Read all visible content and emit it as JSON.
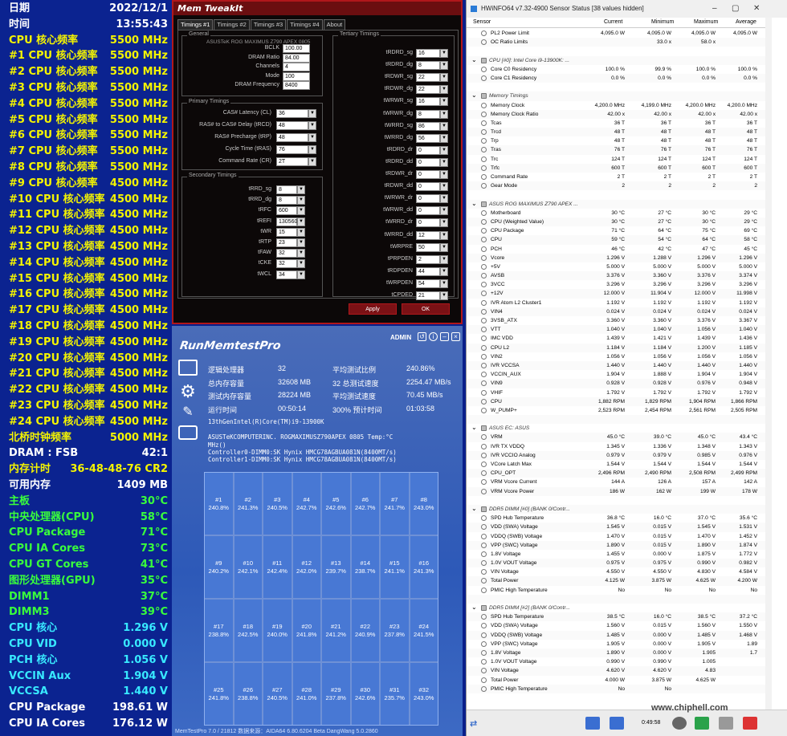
{
  "osd": [
    [
      "日期",
      "2022/12/1",
      "w"
    ],
    [
      "时间",
      "13:55:43",
      "w"
    ],
    [
      "CPU 核心频率",
      "5500 MHz",
      "y"
    ],
    [
      "#1 CPU 核心频率",
      "5500 MHz",
      "y"
    ],
    [
      "#2 CPU 核心频率",
      "5500 MHz",
      "y"
    ],
    [
      "#3 CPU 核心频率",
      "5500 MHz",
      "y"
    ],
    [
      "#4 CPU 核心频率",
      "5500 MHz",
      "y"
    ],
    [
      "#5 CPU 核心频率",
      "5500 MHz",
      "y"
    ],
    [
      "#6 CPU 核心频率",
      "5500 MHz",
      "y"
    ],
    [
      "#7 CPU 核心频率",
      "5500 MHz",
      "y"
    ],
    [
      "#8 CPU 核心频率",
      "5500 MHz",
      "y"
    ],
    [
      "#9 CPU 核心频率",
      "4500 MHz",
      "y"
    ],
    [
      "#10 CPU 核心频率",
      "4500 MHz",
      "y"
    ],
    [
      "#11 CPU 核心频率",
      "4500 MHz",
      "y"
    ],
    [
      "#12 CPU 核心频率",
      "4500 MHz",
      "y"
    ],
    [
      "#13 CPU 核心频率",
      "4500 MHz",
      "y"
    ],
    [
      "#14 CPU 核心频率",
      "4500 MHz",
      "y"
    ],
    [
      "#15 CPU 核心频率",
      "4500 MHz",
      "y"
    ],
    [
      "#16 CPU 核心频率",
      "4500 MHz",
      "y"
    ],
    [
      "#17 CPU 核心频率",
      "4500 MHz",
      "y"
    ],
    [
      "#18 CPU 核心频率",
      "4500 MHz",
      "y"
    ],
    [
      "#19 CPU 核心频率",
      "4500 MHz",
      "y"
    ],
    [
      "#20 CPU 核心频率",
      "4500 MHz",
      "y"
    ],
    [
      "#21 CPU 核心频率",
      "4500 MHz",
      "y"
    ],
    [
      "#22 CPU 核心频率",
      "4500 MHz",
      "y"
    ],
    [
      "#23 CPU 核心频率",
      "4500 MHz",
      "y"
    ],
    [
      "#24 CPU 核心频率",
      "4500 MHz",
      "y"
    ],
    [
      "北桥时钟频率",
      "5000 MHz",
      "y"
    ],
    [
      "DRAM : FSB",
      "42:1",
      "w"
    ],
    [
      "内存计时",
      "36-48-48-76 CR2",
      "y"
    ],
    [
      "可用内存",
      "1409 MB",
      "w"
    ],
    [
      "主板",
      "30°C",
      "g"
    ],
    [
      "中央处理器(CPU)",
      "58°C",
      "g"
    ],
    [
      "CPU Package",
      "71°C",
      "g"
    ],
    [
      "CPU IA Cores",
      "73°C",
      "g"
    ],
    [
      "CPU GT Cores",
      "41°C",
      "g"
    ],
    [
      "图形处理器(GPU)",
      "35°C",
      "g"
    ],
    [
      "DIMM1",
      "37°C",
      "g"
    ],
    [
      "DIMM3",
      "39°C",
      "g"
    ],
    [
      "CPU 核心",
      "1.296 V",
      "c"
    ],
    [
      "CPU VID",
      "0.000 V",
      "c"
    ],
    [
      "PCH 核心",
      "1.056 V",
      "c"
    ],
    [
      "VCCIN Aux",
      "1.904 V",
      "c"
    ],
    [
      "VCCSA",
      "1.440 V",
      "c"
    ],
    [
      "CPU Package",
      "198.61 W",
      "w"
    ],
    [
      "CPU IA Cores",
      "176.12 W",
      "w"
    ]
  ],
  "memtweak": {
    "title": "Mem TweakIt",
    "tabs": [
      "Timings #1",
      "Timings #2",
      "Timings #3",
      "Timings #4",
      "About"
    ],
    "general_label": "General",
    "board": "ASUSTeK ROG MAXIMUS Z790 APEX 0805",
    "general": [
      [
        "BCLK",
        "100.00"
      ],
      [
        "DRAM Ratio",
        "84.00"
      ],
      [
        "Channels",
        "4"
      ],
      [
        "Mode",
        "100"
      ],
      [
        "DRAM Frequency",
        "8400"
      ]
    ],
    "primary_label": "Primary Timings",
    "primary": [
      [
        "CAS# Latency (CL)",
        "36"
      ],
      [
        "RAS# to CAS# Delay (tRCD)",
        "48"
      ],
      [
        "RAS# Precharge (tRP)",
        "48"
      ],
      [
        "Cycle Time (tRAS)",
        "76"
      ],
      [
        "Command Rate (CR)",
        "2T"
      ]
    ],
    "secondary_label": "Secondary Timings",
    "secondary": [
      [
        "tRRD_sg",
        "8"
      ],
      [
        "tRRD_dg",
        "8"
      ],
      [
        "tRFC",
        "600"
      ],
      [
        "tREFI",
        "130560"
      ],
      [
        "tWR",
        "15"
      ],
      [
        "tRTP",
        "23"
      ],
      [
        "tFAW",
        "32"
      ],
      [
        "tCKE",
        "32"
      ],
      [
        "tWCL",
        "34"
      ]
    ],
    "tertiary_label": "Tertiary Timings",
    "tertiary": [
      [
        "tRDRD_sg",
        "16"
      ],
      [
        "tRDRD_dg",
        "8"
      ],
      [
        "tRDWR_sg",
        "22"
      ],
      [
        "tRDWR_dg",
        "22"
      ],
      [
        "tWRWR_sg",
        "16"
      ],
      [
        "tWRWR_dg",
        "8"
      ],
      [
        "tWRRD_sg",
        "86"
      ],
      [
        "tWRRD_dg",
        "56"
      ],
      [
        "tRDRD_dr",
        "0"
      ],
      [
        "tRDRD_dd",
        "0"
      ],
      [
        "tRDWR_dr",
        "0"
      ],
      [
        "tRDWR_dd",
        "0"
      ],
      [
        "tWRWR_dr",
        "0"
      ],
      [
        "tWRWR_dd",
        "0"
      ],
      [
        "tWRRD_dr",
        "0"
      ],
      [
        "tWRRD_dd",
        "12"
      ],
      [
        "tWRPRE",
        "50"
      ],
      [
        "tPRPDEN",
        "2"
      ],
      [
        "tRDPDEN",
        "44"
      ],
      [
        "tWRPDEN",
        "54"
      ],
      [
        "tCPDED",
        "21"
      ]
    ],
    "apply": "Apply",
    "ok": "OK"
  },
  "rmt": {
    "logo": "RunMemtestPro",
    "admin": "ADMIN",
    "stats": [
      [
        "逻辑处理器",
        "32",
        "平均测试比例",
        "240.86%"
      ],
      [
        "总内存容量",
        "32608 MB",
        "32 总测试速度",
        "2254.47 MB/s"
      ],
      [
        "测试内存容量",
        "28224 MB",
        "平均测试速度",
        "70.45 MB/s"
      ],
      [
        "运行时间",
        "00:50:14",
        "300% 预计时间",
        "01:03:58"
      ]
    ],
    "cpu": "13thGenIntel(R)Core(TM)i9-13900K",
    "board": "ASUSTeKCOMPUTERINC. ROGMAXIMUSZ790APEX 0805 Temp:°C",
    "mhz": "MHz()",
    "ctrl0": "Controller0-DIMM0:SK Hynix HMCG78AGBUA081N(8400MT/s)",
    "ctrl1": "Controller1-DIMM0:SK Hynix HMCG78AGBUA081N(8400MT/s)",
    "cells": [
      "240.8%",
      "241.3%",
      "240.5%",
      "242.7%",
      "242.6%",
      "242.7%",
      "241.7%",
      "243.0%",
      "240.2%",
      "242.1%",
      "242.4%",
      "242.0%",
      "239.7%",
      "238.7%",
      "241.1%",
      "241.3%",
      "238.8%",
      "242.5%",
      "240.0%",
      "241.8%",
      "241.2%",
      "240.9%",
      "237.8%",
      "241.5%",
      "241.8%",
      "238.8%",
      "240.5%",
      "241.0%",
      "237.8%",
      "242.6%",
      "235.7%",
      "243.0%"
    ],
    "footer": "MemTestPro 7.0 / 21812     数据来源：AIDA64 6.80.6204 Beta                                    DangWang 5.0.2860"
  },
  "hwinfo": {
    "title": "HWiNFO64 v7.32-4900 Sensor Status [38 values hidden]",
    "cols": [
      "Sensor",
      "Current",
      "Minimum",
      "Maximum",
      "Average"
    ],
    "time": "0:49:58",
    "watermark": "www.chiphell.com",
    "rows": [
      [
        "PL2 Power Limit",
        "4,095.0 W",
        "4,095.0 W",
        "4,095.0 W",
        "4,095.0 W",
        0
      ],
      [
        "OC Ratio Limits",
        "",
        "33.0 x",
        "58.0 x",
        "",
        0
      ],
      [
        "",
        "",
        "",
        "",
        "",
        2
      ],
      [
        "CPU [#0]: Intel Core i9-13900K: ...",
        "",
        "",
        "",
        "",
        1
      ],
      [
        "Core C0 Residency",
        "100.0 %",
        "99.9 %",
        "100.0 %",
        "100.0 %",
        0
      ],
      [
        "Core C1 Residency",
        "0.0 %",
        "0.0 %",
        "0.0 %",
        "0.0 %",
        0
      ],
      [
        "",
        "",
        "",
        "",
        "",
        2
      ],
      [
        "Memory Timings",
        "",
        "",
        "",
        "",
        1
      ],
      [
        "Memory Clock",
        "4,200.0 MHz",
        "4,199.0 MHz",
        "4,200.0 MHz",
        "4,200.0 MHz",
        0
      ],
      [
        "Memory Clock Ratio",
        "42.00 x",
        "42.00 x",
        "42.00 x",
        "42.00 x",
        0
      ],
      [
        "Tcas",
        "36 T",
        "36 T",
        "36 T",
        "36 T",
        0
      ],
      [
        "Trcd",
        "48 T",
        "48 T",
        "48 T",
        "48 T",
        0
      ],
      [
        "Trp",
        "48 T",
        "48 T",
        "48 T",
        "48 T",
        0
      ],
      [
        "Tras",
        "76 T",
        "76 T",
        "76 T",
        "76 T",
        0
      ],
      [
        "Trc",
        "124 T",
        "124 T",
        "124 T",
        "124 T",
        0
      ],
      [
        "Trfc",
        "600 T",
        "600 T",
        "600 T",
        "600 T",
        0
      ],
      [
        "Command Rate",
        "2 T",
        "2 T",
        "2 T",
        "2 T",
        0
      ],
      [
        "Gear Mode",
        "2",
        "2",
        "2",
        "2",
        0
      ],
      [
        "",
        "",
        "",
        "",
        "",
        2
      ],
      [
        "ASUS ROG MAXIMUS Z790 APEX ...",
        "",
        "",
        "",
        "",
        1
      ],
      [
        "Motherboard",
        "30 °C",
        "27 °C",
        "30 °C",
        "29 °C",
        0
      ],
      [
        "CPU (Weighted Value)",
        "30 °C",
        "27 °C",
        "30 °C",
        "29 °C",
        0
      ],
      [
        "CPU Package",
        "71 °C",
        "64 °C",
        "75 °C",
        "69 °C",
        0
      ],
      [
        "CPU",
        "59 °C",
        "54 °C",
        "64 °C",
        "58 °C",
        0
      ],
      [
        "PCH",
        "46 °C",
        "42 °C",
        "47 °C",
        "45 °C",
        0
      ],
      [
        "Vcore",
        "1.296 V",
        "1.288 V",
        "1.296 V",
        "1.296 V",
        0
      ],
      [
        "+5V",
        "5.000 V",
        "5.000 V",
        "5.000 V",
        "5.000 V",
        0
      ],
      [
        "AVSB",
        "3.376 V",
        "3.360 V",
        "3.376 V",
        "3.374 V",
        0
      ],
      [
        "3VCC",
        "3.296 V",
        "3.296 V",
        "3.296 V",
        "3.296 V",
        0
      ],
      [
        "+12V",
        "12.000 V",
        "11.904 V",
        "12.000 V",
        "11.998 V",
        0
      ],
      [
        "IVR Atom L2 Cluster1",
        "1.192 V",
        "1.192 V",
        "1.192 V",
        "1.192 V",
        0
      ],
      [
        "VIN4",
        "0.024 V",
        "0.024 V",
        "0.024 V",
        "0.024 V",
        0
      ],
      [
        "3VSB_ATX",
        "3.360 V",
        "3.360 V",
        "3.376 V",
        "3.367 V",
        0
      ],
      [
        "VTT",
        "1.040 V",
        "1.040 V",
        "1.056 V",
        "1.040 V",
        0
      ],
      [
        "IMC VDD",
        "1.439 V",
        "1.421 V",
        "1.439 V",
        "1.436 V",
        0
      ],
      [
        "CPU L2",
        "1.184 V",
        "1.184 V",
        "1.200 V",
        "1.185 V",
        0
      ],
      [
        "VIN2",
        "1.056 V",
        "1.056 V",
        "1.056 V",
        "1.056 V",
        0
      ],
      [
        "IVR VCCSA",
        "1.440 V",
        "1.440 V",
        "1.440 V",
        "1.440 V",
        0
      ],
      [
        "VCCIN_AUX",
        "1.904 V",
        "1.888 V",
        "1.904 V",
        "1.904 V",
        0
      ],
      [
        "VIN9",
        "0.928 V",
        "0.928 V",
        "0.976 V",
        "0.948 V",
        0
      ],
      [
        "VHIF",
        "1.792 V",
        "1.792 V",
        "1.792 V",
        "1.792 V",
        0
      ],
      [
        "CPU",
        "1,882 RPM",
        "1,829 RPM",
        "1,904 RPM",
        "1,866 RPM",
        0
      ],
      [
        "W_PUMP+",
        "2,523 RPM",
        "2,454 RPM",
        "2,561 RPM",
        "2,505 RPM",
        0
      ],
      [
        "",
        "",
        "",
        "",
        "",
        2
      ],
      [
        "ASUS EC: ASUS",
        "",
        "",
        "",
        "",
        1
      ],
      [
        "VRM",
        "45.0 °C",
        "39.0 °C",
        "45.0 °C",
        "43.4 °C",
        0
      ],
      [
        "IVR TX VDDQ",
        "1.345 V",
        "1.336 V",
        "1.348 V",
        "1.343 V",
        0
      ],
      [
        "IVR VCCIO Analog",
        "0.979 V",
        "0.979 V",
        "0.985 V",
        "0.976 V",
        0
      ],
      [
        "VCore Latch Max",
        "1.544 V",
        "1.544 V",
        "1.544 V",
        "1.544 V",
        0
      ],
      [
        "CPU_OPT",
        "2,496 RPM",
        "2,490 RPM",
        "2,508 RPM",
        "2,499 RPM",
        0
      ],
      [
        "VRM Vcore Current",
        "144 A",
        "126 A",
        "157 A",
        "142 A",
        0
      ],
      [
        "VRM Vcore Power",
        "186 W",
        "162 W",
        "199 W",
        "178 W",
        0
      ],
      [
        "",
        "",
        "",
        "",
        "",
        2
      ],
      [
        "DDR5 DIMM [#0] (BANK 0/Contr...",
        "",
        "",
        "",
        "",
        1
      ],
      [
        "SPD Hub Temperature",
        "36.8 °C",
        "16.0 °C",
        "37.0 °C",
        "35.6 °C",
        0
      ],
      [
        "VDD (SWA) Voltage",
        "1.545 V",
        "0.015 V",
        "1.545 V",
        "1.531 V",
        0
      ],
      [
        "VDDQ (SWB) Voltage",
        "1.470 V",
        "0.015 V",
        "1.470 V",
        "1.452 V",
        0
      ],
      [
        "VPP (SWC) Voltage",
        "1.890 V",
        "0.015 V",
        "1.890 V",
        "1.874 V",
        0
      ],
      [
        "1.8V Voltage",
        "1.455 V",
        "0.000 V",
        "1.875 V",
        "1.772 V",
        0
      ],
      [
        "1.0V VOUT Voltage",
        "0.975 V",
        "0.975 V",
        "0.990 V",
        "0.982 V",
        0
      ],
      [
        "VIN Voltage",
        "4.550 V",
        "4.550 V",
        "4.830 V",
        "4.584 V",
        0
      ],
      [
        "Total Power",
        "4.125 W",
        "3.875 W",
        "4.625 W",
        "4.200 W",
        0
      ],
      [
        "PMIC High Temperature",
        "No",
        "No",
        "No",
        "No",
        0
      ],
      [
        "",
        "",
        "",
        "",
        "",
        2
      ],
      [
        "DDR5 DIMM [#2] (BANK 0/Contr...",
        "",
        "",
        "",
        "",
        1
      ],
      [
        "SPD Hub Temperature",
        "38.5 °C",
        "16.0 °C",
        "38.5 °C",
        "37.2 °C",
        0
      ],
      [
        "VDD (SWA) Voltage",
        "1.560 V",
        "0.015 V",
        "1.560 V",
        "1.550 V",
        0
      ],
      [
        "VDDQ (SWB) Voltage",
        "1.485 V",
        "0.000 V",
        "1.485 V",
        "1.468 V",
        0
      ],
      [
        "VPP (SWC) Voltage",
        "1.905 V",
        "0.000 V",
        "1.905 V",
        "1.89",
        0
      ],
      [
        "1.8V Voltage",
        "1.890 V",
        "0.000 V",
        "1.905",
        "1.7",
        0
      ],
      [
        "1.0V VOUT Voltage",
        "0.990 V",
        "0.990 V",
        "1.005",
        "",
        0
      ],
      [
        "VIN Voltage",
        "4.620 V",
        "4.620 V",
        "4.83",
        "",
        0
      ],
      [
        "Total Power",
        "4.000 W",
        "3.875 W",
        "4.625 W",
        "",
        0
      ],
      [
        "PMIC High Temperature",
        "No",
        "No",
        "",
        "",
        0
      ]
    ]
  }
}
